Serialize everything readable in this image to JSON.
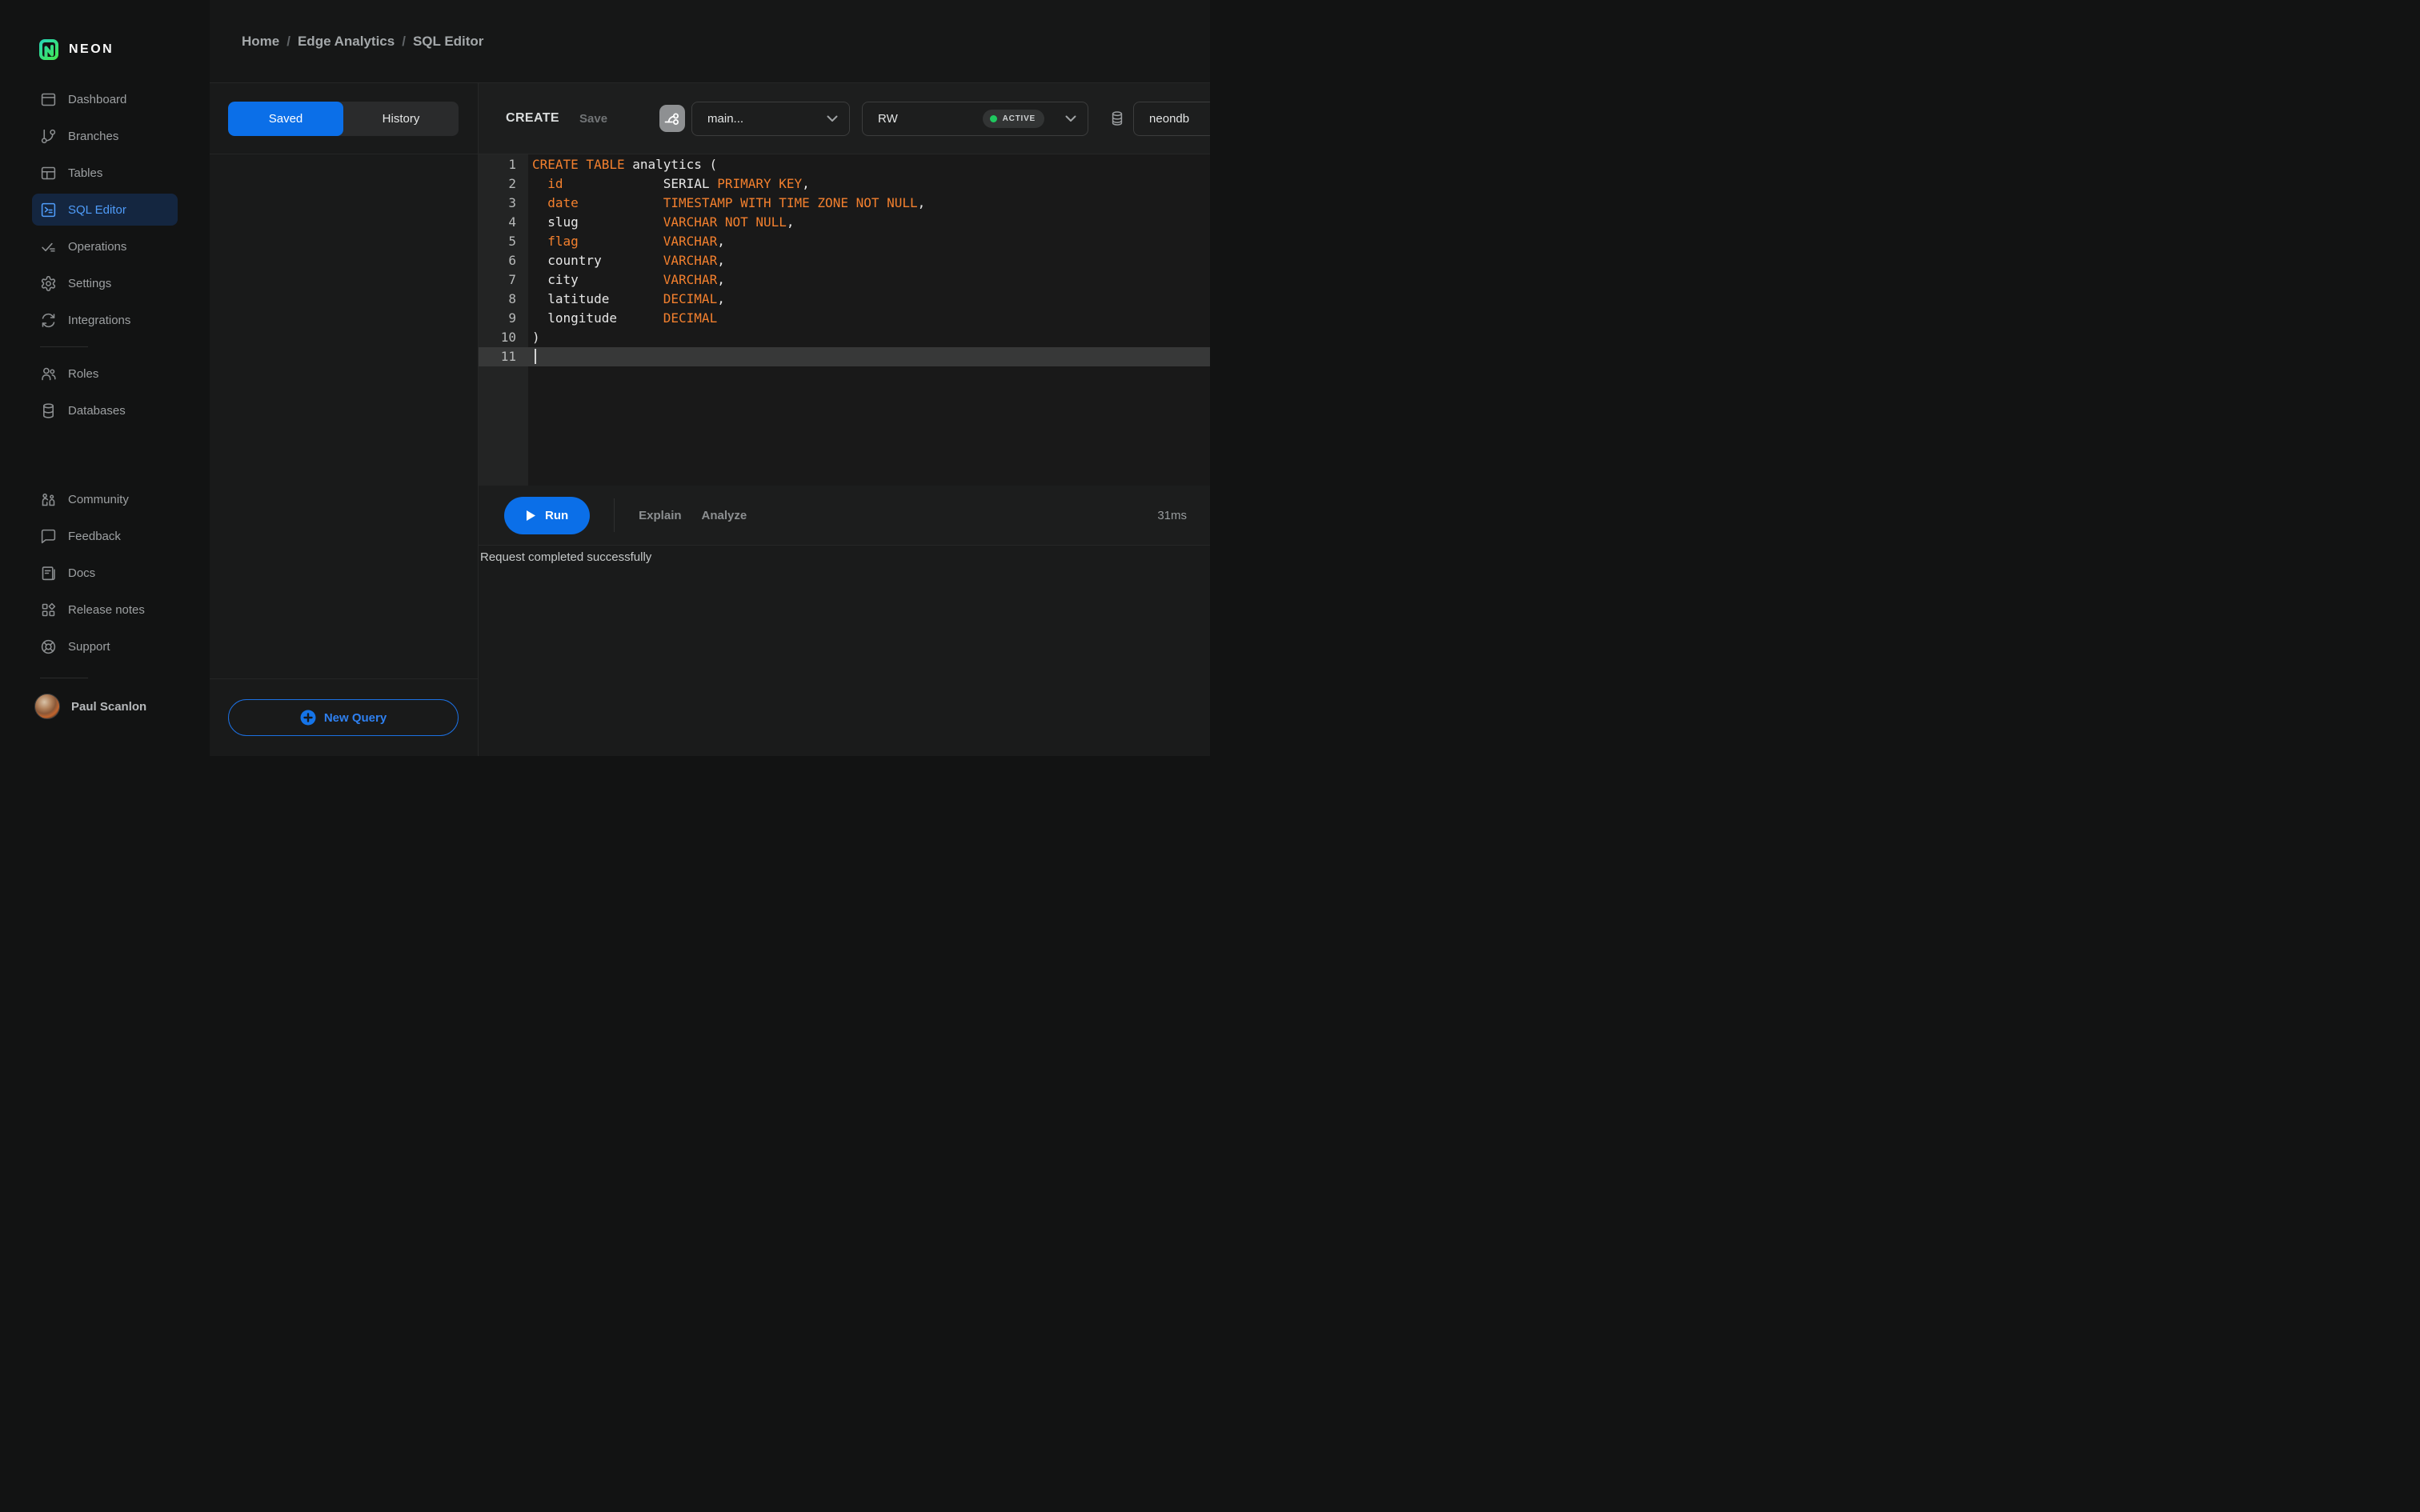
{
  "brand": {
    "name": "NEON"
  },
  "breadcrumb": {
    "separator": "/",
    "items": [
      "Home",
      "Edge Analytics",
      "SQL Editor"
    ]
  },
  "sidebar": {
    "primary": [
      {
        "label": "Dashboard",
        "icon": "dashboard-icon",
        "active": false
      },
      {
        "label": "Branches",
        "icon": "branches-icon",
        "active": false
      },
      {
        "label": "Tables",
        "icon": "tables-icon",
        "active": false
      },
      {
        "label": "SQL Editor",
        "icon": "sql-editor-icon",
        "active": true
      },
      {
        "label": "Operations",
        "icon": "operations-icon",
        "active": false
      },
      {
        "label": "Settings",
        "icon": "settings-icon",
        "active": false
      },
      {
        "label": "Integrations",
        "icon": "integrations-icon",
        "active": false
      }
    ],
    "secondary": [
      {
        "label": "Roles",
        "icon": "roles-icon",
        "active": false
      },
      {
        "label": "Databases",
        "icon": "databases-icon",
        "active": false
      }
    ],
    "tertiary": [
      {
        "label": "Community",
        "icon": "community-icon",
        "active": false
      },
      {
        "label": "Feedback",
        "icon": "feedback-icon",
        "active": false
      },
      {
        "label": "Docs",
        "icon": "docs-icon",
        "active": false
      },
      {
        "label": "Release notes",
        "icon": "release-notes-icon",
        "active": false
      },
      {
        "label": "Support",
        "icon": "support-icon",
        "active": false
      }
    ],
    "user": {
      "name": "Paul Scanlon"
    }
  },
  "queries_panel": {
    "tabs": [
      {
        "label": "Saved",
        "active": true
      },
      {
        "label": "History",
        "active": false
      }
    ],
    "new_query_label": "New Query"
  },
  "editor": {
    "query_title": "CREATE",
    "save_label": "Save",
    "branch_select": {
      "value": "main..."
    },
    "compute_select": {
      "value": "RW",
      "status_badge": "ACTIVE"
    },
    "database_select": {
      "value": "neondb"
    },
    "run_label": "Run",
    "explain_label": "Explain",
    "analyze_label": "Analyze",
    "duration": "31ms",
    "status_message": "Request completed successfully",
    "code_lines": [
      {
        "n": 1,
        "tokens": [
          [
            "kw",
            "CREATE TABLE"
          ],
          [
            "pl",
            " analytics ("
          ]
        ]
      },
      {
        "n": 2,
        "tokens": [
          [
            "pl",
            "  "
          ],
          [
            "kw",
            "id"
          ],
          [
            "pl",
            "             SERIAL "
          ],
          [
            "kw",
            "PRIMARY KEY"
          ],
          [
            "pl",
            ","
          ]
        ]
      },
      {
        "n": 3,
        "tokens": [
          [
            "pl",
            "  "
          ],
          [
            "kw",
            "date"
          ],
          [
            "pl",
            "           "
          ],
          [
            "kw",
            "TIMESTAMP WITH TIME ZONE NOT NULL"
          ],
          [
            "pl",
            ","
          ]
        ]
      },
      {
        "n": 4,
        "tokens": [
          [
            "pl",
            "  slug           "
          ],
          [
            "kw",
            "VARCHAR NOT NULL"
          ],
          [
            "pl",
            ","
          ]
        ]
      },
      {
        "n": 5,
        "tokens": [
          [
            "pl",
            "  "
          ],
          [
            "kw",
            "flag"
          ],
          [
            "pl",
            "           "
          ],
          [
            "kw",
            "VARCHAR"
          ],
          [
            "pl",
            ","
          ]
        ]
      },
      {
        "n": 6,
        "tokens": [
          [
            "pl",
            "  country        "
          ],
          [
            "kw",
            "VARCHAR"
          ],
          [
            "pl",
            ","
          ]
        ]
      },
      {
        "n": 7,
        "tokens": [
          [
            "pl",
            "  city           "
          ],
          [
            "kw",
            "VARCHAR"
          ],
          [
            "pl",
            ","
          ]
        ]
      },
      {
        "n": 8,
        "tokens": [
          [
            "pl",
            "  latitude       "
          ],
          [
            "kw",
            "DECIMAL"
          ],
          [
            "pl",
            ","
          ]
        ]
      },
      {
        "n": 9,
        "tokens": [
          [
            "pl",
            "  longitude      "
          ],
          [
            "kw",
            "DECIMAL"
          ]
        ]
      },
      {
        "n": 10,
        "tokens": [
          [
            "pl",
            ")"
          ]
        ]
      },
      {
        "n": 11,
        "tokens": [],
        "active": true,
        "cursor": true
      }
    ]
  },
  "colors": {
    "accent_blue": "#0b6fe8",
    "keyword_orange": "#f3802e",
    "active_green": "#1fc95f",
    "brand_gradient_start": "#23d3c2",
    "brand_gradient_end": "#45e845",
    "active_item_bg": "#142640"
  }
}
